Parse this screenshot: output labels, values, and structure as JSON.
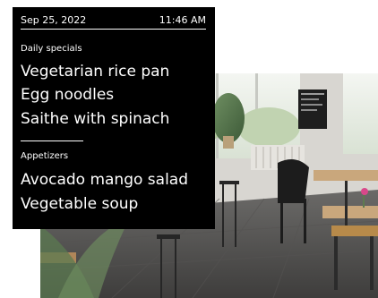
{
  "menu": {
    "date": "Sep 25, 2022",
    "time": "11:46 AM",
    "sections": [
      {
        "title": "Daily specials",
        "items": [
          "Vegetarian rice pan",
          "Egg noodles",
          "Saithe with spinach"
        ]
      },
      {
        "title": "Appetizers",
        "items": [
          "Avocado mango salad",
          "Vegetable soup"
        ]
      }
    ]
  },
  "photo": {
    "subject": "cafe-interior-photo"
  },
  "colors": {
    "panel_bg": "#000000",
    "panel_text": "#ffffff"
  }
}
